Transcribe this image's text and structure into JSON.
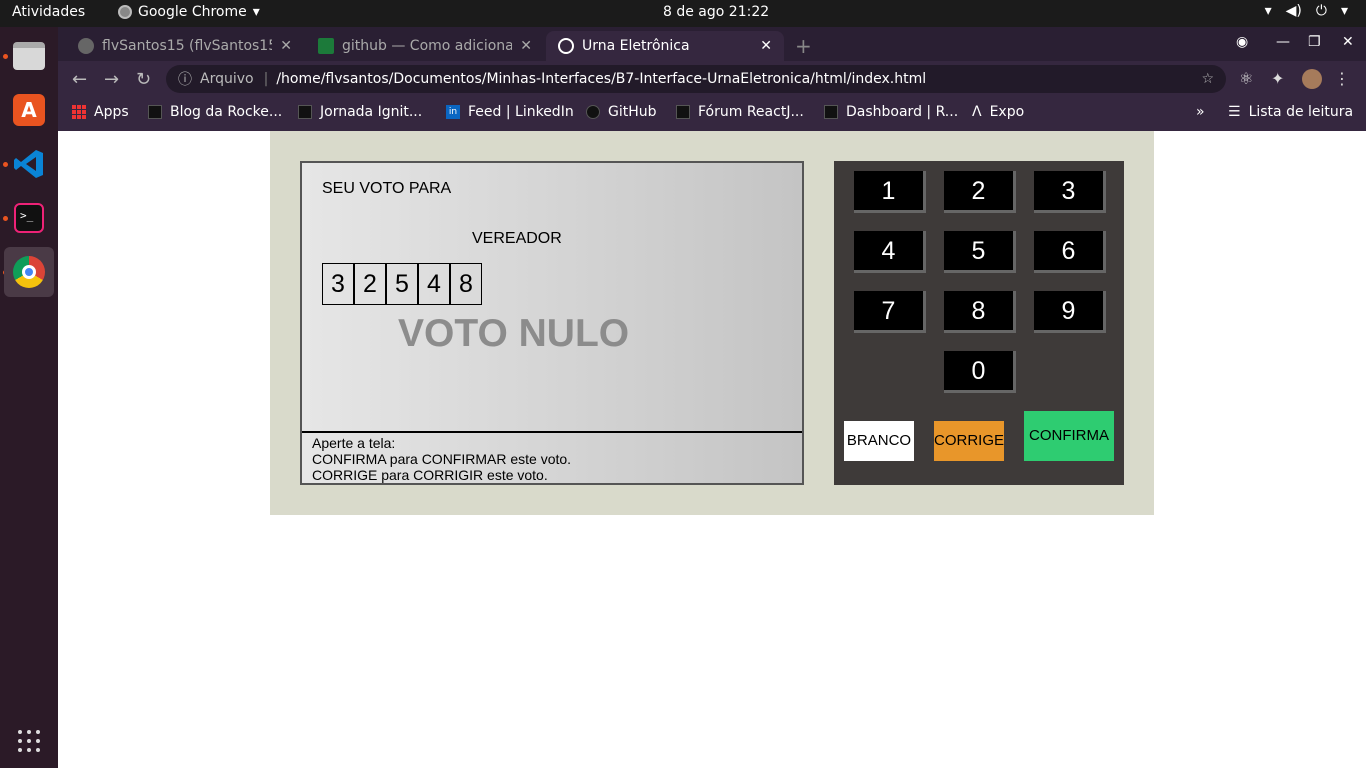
{
  "topbar": {
    "activities": "Atividades",
    "app_name": "Google Chrome",
    "clock": "8 de ago  21:22"
  },
  "browser": {
    "tabs": [
      {
        "title": "flvSantos15 (flvSantos15)"
      },
      {
        "title": "github — Como adicionar"
      },
      {
        "title": "Urna Eletrônica"
      }
    ],
    "address": {
      "scheme_label": "Arquivo",
      "url": "/home/flvsantos/Documentos/Minhas-Interfaces/B7-Interface-UrnaEletronica/html/index.html"
    },
    "bookmarks": [
      {
        "label": "Apps"
      },
      {
        "label": "Blog da Rocke..."
      },
      {
        "label": "Jornada Ignit..."
      },
      {
        "label": "Feed | LinkedIn"
      },
      {
        "label": "GitHub"
      },
      {
        "label": "Fórum ReactJ..."
      },
      {
        "label": "Dashboard | R..."
      },
      {
        "label": "Expo"
      }
    ],
    "reading_list": "Lista de leitura"
  },
  "urna": {
    "seu_voto": "SEU VOTO PARA",
    "cargo": "VEREADOR",
    "digitos": [
      "3",
      "2",
      "5",
      "4",
      "8"
    ],
    "resultado": "VOTO NULO",
    "rodape": {
      "linha1": "Aperte a tela:",
      "linha2": "CONFIRMA para CONFIRMAR este voto.",
      "linha3": "CORRIGE para CORRIGIR este voto."
    },
    "teclas": [
      "1",
      "2",
      "3",
      "4",
      "5",
      "6",
      "7",
      "8",
      "9",
      "0"
    ],
    "botoes": {
      "branco": "BRANCO",
      "corrige": "CORRIGE",
      "confirma": "CONFIRMA"
    }
  },
  "colors": {
    "urna_bg": "#d9dacb",
    "teclado_bg": "#3e3a39",
    "corrige": "#e8962a",
    "confirma": "#2ecc71"
  }
}
